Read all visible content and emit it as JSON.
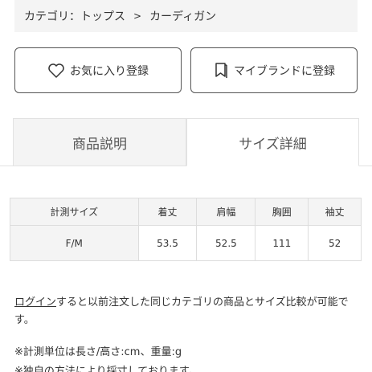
{
  "breadcrumb": {
    "category_label": "カテゴリ：トップス",
    "separator": ">",
    "subcategory": "カーディガン"
  },
  "actions": {
    "favorite_label": "お気に入り登録",
    "brand_label": "マイブランドに登録"
  },
  "tabs": [
    {
      "label": "商品説明",
      "selected": false
    },
    {
      "label": "サイズ詳細",
      "selected": true
    }
  ],
  "size_table": {
    "headers": [
      "計測サイズ",
      "着丈",
      "肩幅",
      "胸囲",
      "袖丈"
    ],
    "rows": [
      [
        "F/M",
        "53.5",
        "52.5",
        "111",
        "52"
      ]
    ]
  },
  "notes": {
    "login_link": "ログイン",
    "compare_text": "すると以前注文した同じカテゴリの商品とサイズ比較が可能です。",
    "units": "※計測単位は長さ/高さ:cm、重量:g",
    "own_method": "※独自の方法により採寸しております。"
  },
  "colors": {
    "border": "#555555",
    "light_bg": "#f4f4f4",
    "text": "#333333"
  }
}
